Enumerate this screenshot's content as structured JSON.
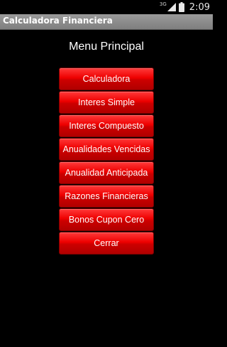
{
  "status_bar": {
    "network": "3G",
    "time": "2:09",
    "icons": [
      "signal-icon",
      "battery-icon"
    ]
  },
  "app_bar": {
    "title": "Calculadora Financiera"
  },
  "menu": {
    "heading": "Menu Principal",
    "buttons": [
      {
        "label": "Calculadora"
      },
      {
        "label": "Interes Simple"
      },
      {
        "label": "Interes Compuesto"
      },
      {
        "label": "Anualidades Vencidas"
      },
      {
        "label": "Anualidad Anticipada"
      },
      {
        "label": "Razones Financieras"
      },
      {
        "label": "Bonos Cupon Cero"
      },
      {
        "label": "Cerrar"
      }
    ]
  },
  "colors": {
    "background": "#000000",
    "title_bar": "#8a8a8a",
    "button": "#e00000",
    "button_text": "#ffffff"
  }
}
